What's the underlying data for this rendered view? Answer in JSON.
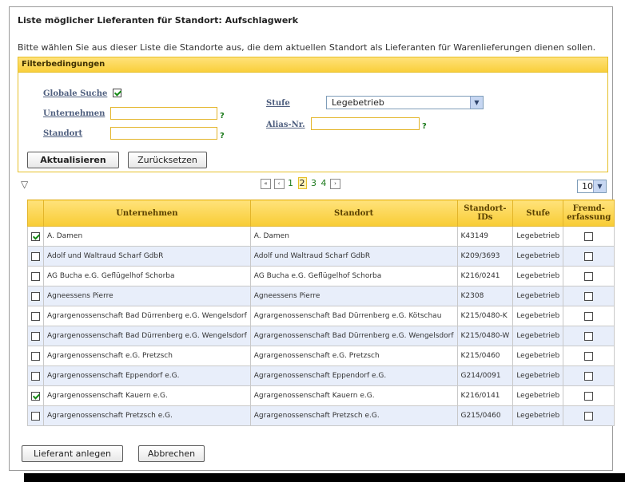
{
  "title": "Liste möglicher Lieferanten für Standort: Aufschlagwerk",
  "intro": "Bitte wählen Sie aus dieser Liste die Standorte aus, die dem aktuellen Standort als Lieferanten für Warenlieferungen dienen sollen.",
  "filter": {
    "header": "Filterbedingungen",
    "global_search_label": "Globale Suche",
    "global_search_checked": true,
    "company_label": "Unternehmen",
    "company_value": "",
    "location_label": "Standort",
    "location_value": "",
    "level_label": "Stufe",
    "level_value": "Legebetrieb",
    "alias_label": "Alias-Nr.",
    "alias_value": "",
    "help": "?",
    "update_button": "Aktualisieren",
    "reset_button": "Zurücksetzen"
  },
  "pager": {
    "pages": [
      "1",
      "2",
      "3",
      "4"
    ],
    "current": "2",
    "page_size": "10"
  },
  "table": {
    "headers": [
      "Unternehmen",
      "Standort",
      "Standort-IDs",
      "Stufe",
      "Fremd-erfassung"
    ],
    "rows": [
      {
        "checked": true,
        "company": "A. Damen",
        "location": "A. Damen",
        "id": "K43149",
        "level": "Legebetrieb",
        "external": false
      },
      {
        "checked": false,
        "company": "Adolf und Waltraud Scharf GdbR",
        "location": "Adolf und Waltraud Scharf GdbR",
        "id": "K209/3693",
        "level": "Legebetrieb",
        "external": false
      },
      {
        "checked": false,
        "company": "AG Bucha e.G. Geflügelhof Schorba",
        "location": "AG Bucha e.G. Geflügelhof Schorba",
        "id": "K216/0241",
        "level": "Legebetrieb",
        "external": false
      },
      {
        "checked": false,
        "company": "Agneessens Pierre",
        "location": "Agneessens Pierre",
        "id": "K2308",
        "level": "Legebetrieb",
        "external": false
      },
      {
        "checked": false,
        "company": "Agrargenossenschaft Bad Dürrenberg e.G. Wengelsdorf",
        "location": "Agrargenossenschaft Bad Dürrenberg e.G. Kötschau",
        "id": "K215/0480-K",
        "level": "Legebetrieb",
        "external": false
      },
      {
        "checked": false,
        "company": "Agrargenossenschaft Bad Dürrenberg e.G. Wengelsdorf",
        "location": "Agrargenossenschaft Bad Dürrenberg e.G. Wengelsdorf",
        "id": "K215/0480-W",
        "level": "Legebetrieb",
        "external": false
      },
      {
        "checked": false,
        "company": "Agrargenossenschaft e.G. Pretzsch",
        "location": "Agrargenossenschaft e.G. Pretzsch",
        "id": "K215/0460",
        "level": "Legebetrieb",
        "external": false
      },
      {
        "checked": false,
        "company": "Agrargenossenschaft Eppendorf e.G.",
        "location": "Agrargenossenschaft Eppendorf e.G.",
        "id": "G214/0091",
        "level": "Legebetrieb",
        "external": false
      },
      {
        "checked": true,
        "company": "Agrargenossenschaft Kauern e.G.",
        "location": "Agrargenossenschaft Kauern e.G.",
        "id": "K216/0141",
        "level": "Legebetrieb",
        "external": false
      },
      {
        "checked": false,
        "company": "Agrargenossenschaft Pretzsch e.G.",
        "location": "Agrargenossenschaft Pretzsch e.G.",
        "id": "G215/0460",
        "level": "Legebetrieb",
        "external": false
      }
    ]
  },
  "actions": {
    "create_button": "Lieferant anlegen",
    "cancel_button": "Abbrechen"
  },
  "colors": {
    "accent_yellow": "#f8cc35",
    "row_alt": "#e8eefa",
    "link_green": "#1c7a1c"
  }
}
